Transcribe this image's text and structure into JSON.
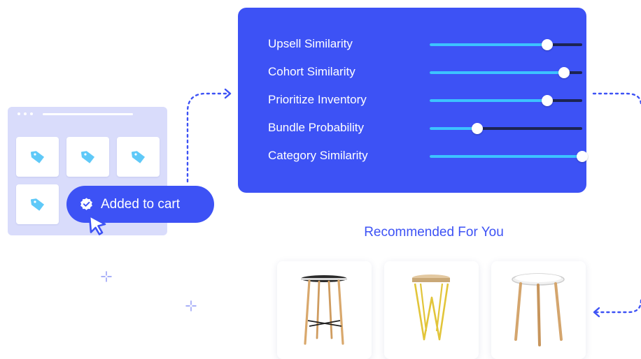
{
  "cart": {
    "added_label": "Added to cart"
  },
  "panel": {
    "sliders": [
      {
        "label": "Upsell Similarity",
        "value": 0.77
      },
      {
        "label": "Cohort Similarity",
        "value": 0.88
      },
      {
        "label": "Prioritize Inventory",
        "value": 0.77
      },
      {
        "label": "Bundle Probability",
        "value": 0.31
      },
      {
        "label": "Category Similarity",
        "value": 1.0
      }
    ]
  },
  "recommendations": {
    "title": "Recommended For You",
    "products": [
      {
        "icon": "bar-table-image"
      },
      {
        "icon": "hairpin-stool-image"
      },
      {
        "icon": "tray-side-table-image"
      }
    ]
  },
  "colors": {
    "accent": "#3d52f5",
    "slider_fill": "#3cc3ff",
    "slider_track": "#1c2452",
    "browser_bg": "#d9dcfb",
    "tag_icon": "#5fc9f8"
  }
}
